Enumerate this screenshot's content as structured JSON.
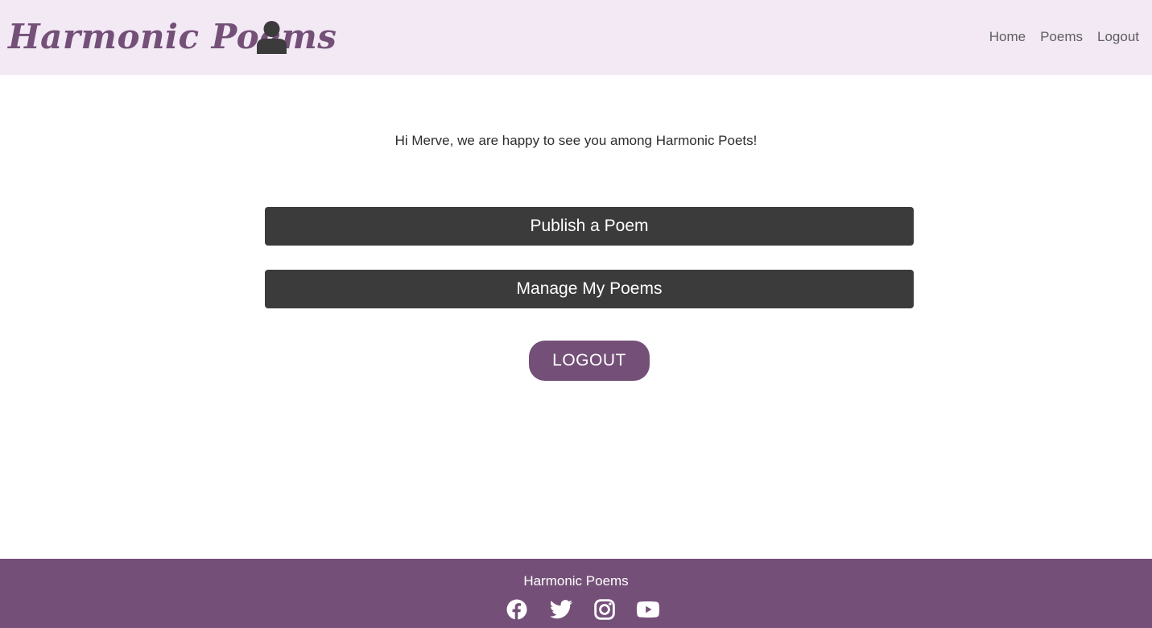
{
  "header": {
    "brand": "Harmonic Poems",
    "user_icon": "user-icon",
    "nav": [
      {
        "label": "Home"
      },
      {
        "label": "Poems"
      },
      {
        "label": "Logout"
      }
    ]
  },
  "main": {
    "greeting": "Hi Merve, we are happy to see you among Harmonic Poets!",
    "publish_label": "Publish a Poem",
    "manage_label": "Manage My Poems",
    "logout_label": "LOGOUT"
  },
  "footer": {
    "title": "Harmonic Poems",
    "social_icons": [
      "facebook-icon",
      "twitter-icon",
      "instagram-icon",
      "youtube-icon"
    ]
  },
  "colors": {
    "brand": "#745078",
    "header_bg": "#f2e9f5",
    "button_dark": "#3b3b3c",
    "footer_bg": "#745078"
  }
}
